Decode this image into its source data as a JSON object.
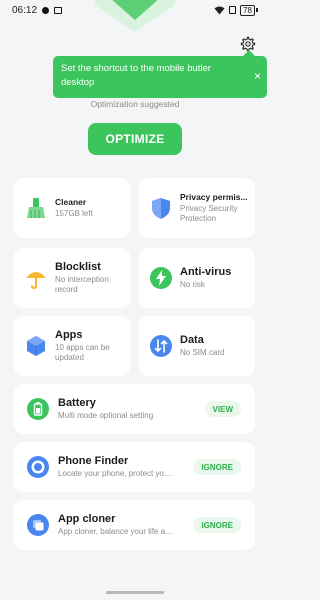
{
  "status_bar": {
    "time": "06:12",
    "battery": "78"
  },
  "toast": {
    "text": "Set the shortcut to the mobile butler desktop",
    "close_icon": "×"
  },
  "optimization": {
    "suggestion": "Optimization suggested",
    "button_label": "OPTIMIZE"
  },
  "tiles": {
    "cleaner": {
      "title": "Cleaner",
      "subtitle": "157GB left",
      "icon": "broom-icon"
    },
    "privacy": {
      "title": "Privacy permis...",
      "subtitle": "Privacy Security Protection",
      "icon": "shield-icon"
    },
    "blocklist": {
      "title": "Blocklist",
      "subtitle": "No interception record",
      "icon": "umbrella-icon"
    },
    "antivirus": {
      "title": "Anti-virus",
      "subtitle": "No risk",
      "icon": "lightning-icon"
    },
    "apps": {
      "title": "Apps",
      "subtitle": "10 apps can be updated",
      "icon": "cube-icon"
    },
    "data": {
      "title": "Data",
      "subtitle": "No SIM card",
      "icon": "data-transfer-icon"
    }
  },
  "rows": {
    "battery": {
      "title": "Battery",
      "subtitle": "Multi mode optional setting",
      "button": "VIEW",
      "icon": "battery-icon"
    },
    "phone_finder": {
      "title": "Phone Finder",
      "subtitle": "Locate your phone, protect your pr...",
      "button": "IGNORE",
      "icon": "locate-icon"
    },
    "app_cloner": {
      "title": "App cloner",
      "subtitle": "App cloner, balance your life and w...",
      "button": "IGNORE",
      "icon": "clone-icon"
    }
  },
  "colors": {
    "accent_green": "#3cc45d",
    "background": "#f4f5f7"
  }
}
